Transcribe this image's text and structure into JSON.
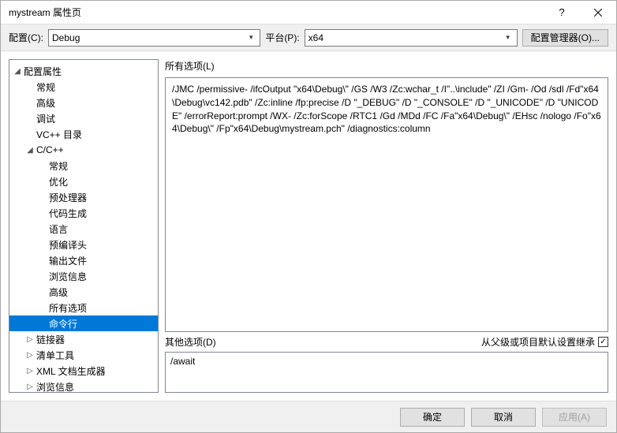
{
  "title": "mystream 属性页",
  "configLabel": "配置(C):",
  "configValue": "Debug",
  "platformLabel": "平台(P):",
  "platformValue": "x64",
  "configMgrLabel": "配置管理器(O)...",
  "tree": {
    "root": "配置属性",
    "general": "常规",
    "advanced": "高级",
    "debugging": "调试",
    "vcdirs": "VC++ 目录",
    "ccpp": "C/C++",
    "cc_general": "常规",
    "cc_opt": "优化",
    "cc_pre": "预处理器",
    "cc_codegen": "代码生成",
    "cc_lang": "语言",
    "cc_pch": "预编译头",
    "cc_output": "输出文件",
    "cc_browse": "浏览信息",
    "cc_adv": "高级",
    "cc_allopts": "所有选项",
    "cc_cmdline": "命令行",
    "linker": "链接器",
    "manifest": "清单工具",
    "xmldoc": "XML 文档生成器",
    "browseinfo": "浏览信息"
  },
  "allOptionsLabel": "所有选项(L)",
  "allOptionsText": "/JMC /permissive- /ifcOutput \"x64\\Debug\\\" /GS /W3 /Zc:wchar_t /I\"..\\include\" /ZI /Gm- /Od /sdl /Fd\"x64\\Debug\\vc142.pdb\" /Zc:inline /fp:precise /D \"_DEBUG\" /D \"_CONSOLE\" /D \"_UNICODE\" /D \"UNICODE\" /errorReport:prompt /WX- /Zc:forScope /RTC1 /Gd /MDd /FC /Fa\"x64\\Debug\\\" /EHsc /nologo /Fo\"x64\\Debug\\\" /Fp\"x64\\Debug\\mystream.pch\" /diagnostics:column ",
  "additionalLabel": "其他选项(D)",
  "inheritLabel": "从父级或项目默认设置继承",
  "inheritChecked": true,
  "additionalValue": "/await",
  "okLabel": "确定",
  "cancelLabel": "取消",
  "applyLabel": "应用(A)"
}
